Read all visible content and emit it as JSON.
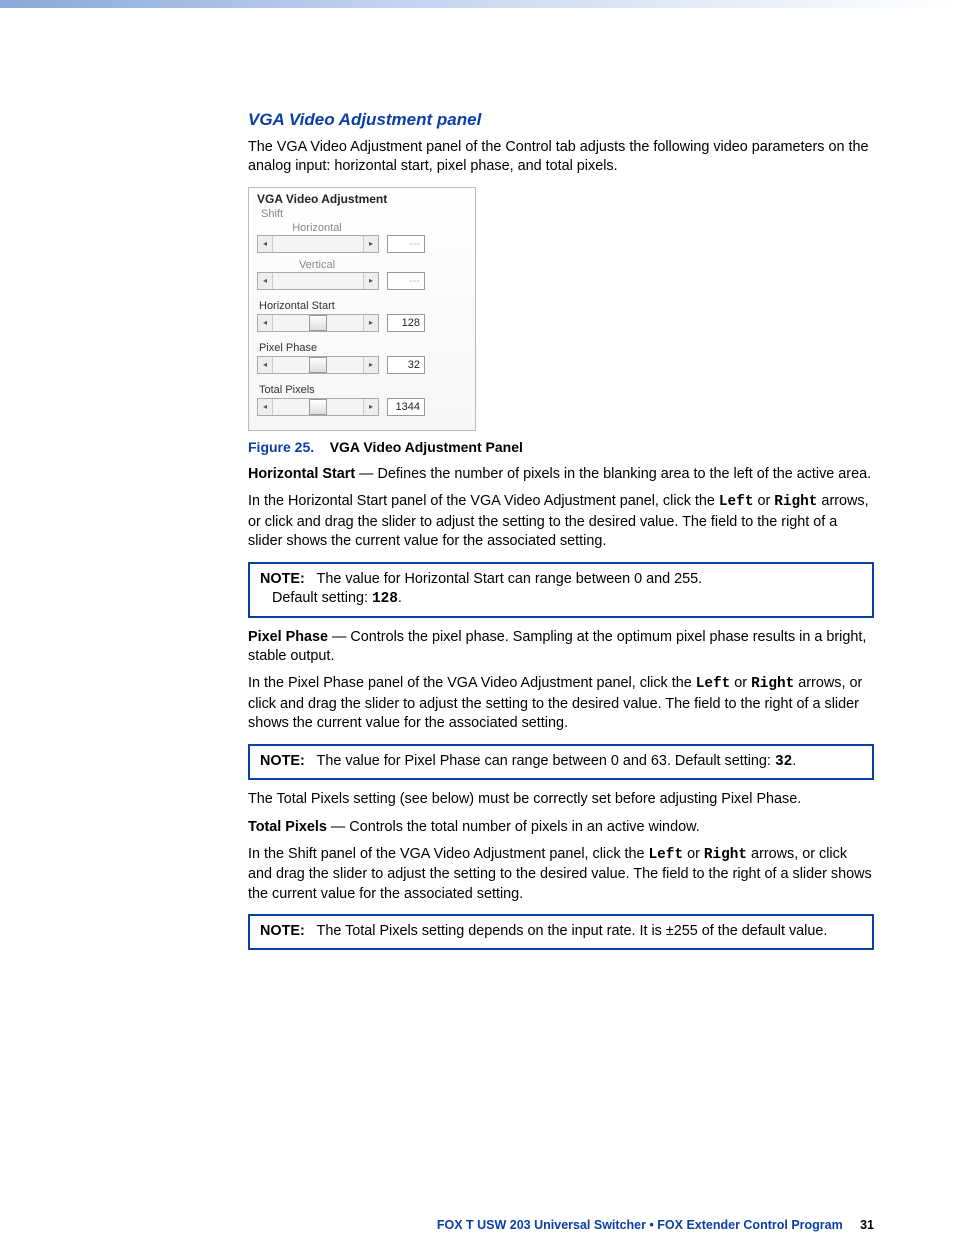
{
  "heading": "VGA Video Adjustment panel",
  "intro": "The VGA Video Adjustment panel of the Control tab adjusts the following video parameters on the analog input: horizontal start, pixel phase, and total pixels.",
  "panel": {
    "title": "VGA Video Adjustment",
    "shift_label": "Shift",
    "horizontal_label": "Horizontal",
    "horizontal_value": "---",
    "vertical_label": "Vertical",
    "vertical_value": "---",
    "hstart_label": "Horizontal Start",
    "hstart_value": "128",
    "phase_label": "Pixel Phase",
    "phase_value": "32",
    "total_label": "Total Pixels",
    "total_value": "1344"
  },
  "figure": {
    "num": "Figure 25.",
    "text": "VGA Video Adjustment Panel"
  },
  "hstart_term": "Horizontal Start",
  "hstart_def": " — Defines the number of pixels in the blanking area to the left of the active area.",
  "hstart_para_a": "In the Horizontal Start panel of the VGA Video Adjustment panel, click the ",
  "kw_left": "Left",
  "kw_or": " or ",
  "kw_right": "Right",
  "hstart_para_b": " arrows, or click and drag the slider to adjust the setting to the desired value. The field to the right of a slider shows the current value for the associated setting.",
  "note1_label": "NOTE:",
  "note1_a": "The value for Horizontal Start can range between 0 and 255.",
  "note1_b": "Default setting: ",
  "note1_val": "128",
  "note1_dot": ".",
  "phase_term": "Pixel Phase",
  "phase_def": " — Controls the pixel phase. Sampling at the optimum pixel phase results in a bright, stable output.",
  "phase_para_a": "In the Pixel Phase panel of the VGA Video Adjustment panel, click the ",
  "phase_para_b": " arrows, or click and drag the slider to adjust the setting to the desired value. The field to the right of a slider shows the current value for the associated setting.",
  "note2_label": "NOTE:",
  "note2_a": "The value for Pixel Phase can range between 0 and 63. Default setting: ",
  "note2_val": "32",
  "note2_dot": ".",
  "between_para": "The Total Pixels setting (see below) must be correctly set before adjusting Pixel Phase.",
  "total_term": "Total Pixels",
  "total_def": " — Controls the total number of pixels in an active window.",
  "total_para_a": "In the Shift panel of the VGA Video Adjustment panel, click the ",
  "total_para_b": " arrows, or click and drag the slider to adjust the setting to the desired value. The field to the right of a slider shows the current value for the associated setting.",
  "note3_label": "NOTE:",
  "note3_a": "The Total Pixels setting depends on the input rate. It is ±255 of the default value.",
  "footer_product": "FOX T USW 203 Universal Switcher • FOX Extender Control Program",
  "footer_page": "31"
}
